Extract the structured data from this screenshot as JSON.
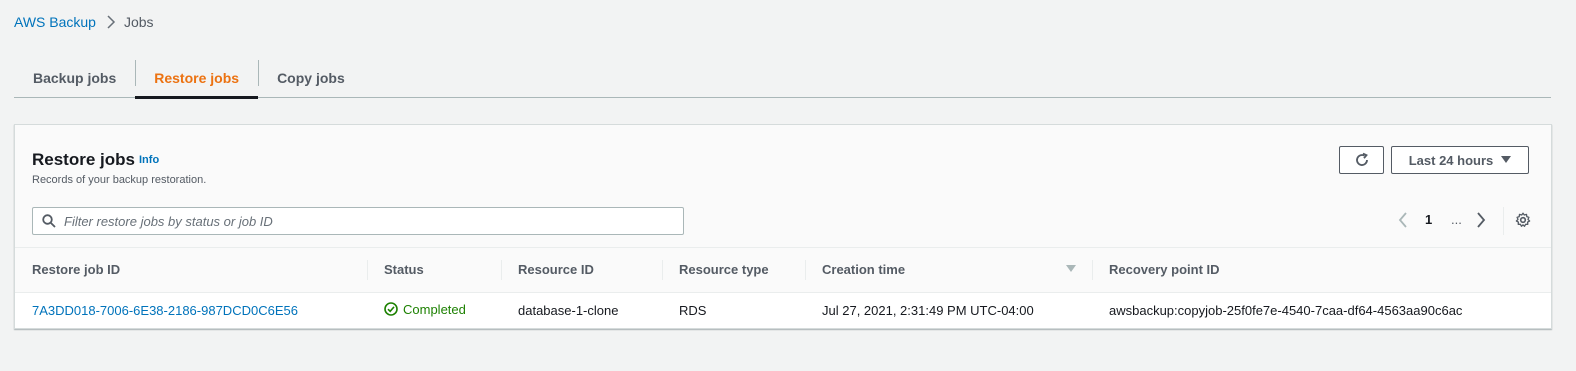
{
  "breadcrumb": {
    "root": "AWS Backup",
    "current": "Jobs"
  },
  "tabs": [
    {
      "label": "Backup jobs",
      "active": false
    },
    {
      "label": "Restore jobs",
      "active": true
    },
    {
      "label": "Copy jobs",
      "active": false
    }
  ],
  "panel": {
    "title": "Restore jobs",
    "info": "Info",
    "description": "Records of your backup restoration.",
    "refresh_icon": "refresh-icon",
    "time_range": "Last 24 hours",
    "search_placeholder": "Filter restore jobs by status or job ID",
    "pagination": {
      "current_page": "1",
      "ellipsis": "..."
    }
  },
  "table": {
    "columns": [
      "Restore job ID",
      "Status",
      "Resource ID",
      "Resource type",
      "Creation time",
      "Recovery point ID"
    ],
    "rows": [
      {
        "restore_job_id": "7A3DD018-7006-6E38-2186-987DCD0C6E56",
        "status": "Completed",
        "resource_id": "database-1-clone",
        "resource_type": "RDS",
        "creation_time": "Jul 27, 2021, 2:31:49 PM UTC-04:00",
        "recovery_point_id": "awsbackup:copyjob-25f0fe7e-4540-7caa-df64-4563aa90c6ac"
      }
    ]
  },
  "colors": {
    "link": "#0073bb",
    "active_tab": "#ec7211",
    "success": "#1d8102",
    "background": "#f2f3f3"
  }
}
